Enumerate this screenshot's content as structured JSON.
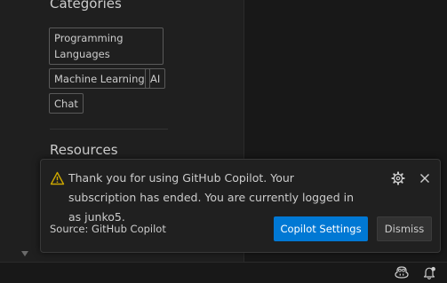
{
  "sidebar": {
    "categories_heading": "Categories",
    "tags": [
      "Programming Languages",
      "Machine Learning",
      "AI",
      "Chat"
    ],
    "resources_heading": "Resources"
  },
  "notification": {
    "message": "Thank you for using GitHub Copilot. Your subscription has ended. You are currently logged in as junko5.",
    "source": "Source: GitHub Copilot",
    "primary_button": "Copilot Settings",
    "secondary_button": "Dismiss",
    "icons": {
      "warning": "warning-icon",
      "settings": "gear-icon",
      "close": "close-icon"
    }
  },
  "status_bar": {
    "icons": [
      "copilot-icon",
      "bell-icon"
    ]
  },
  "colors": {
    "accent": "#0078d4",
    "warning": "#cca700",
    "background": "#1f1f1f"
  }
}
